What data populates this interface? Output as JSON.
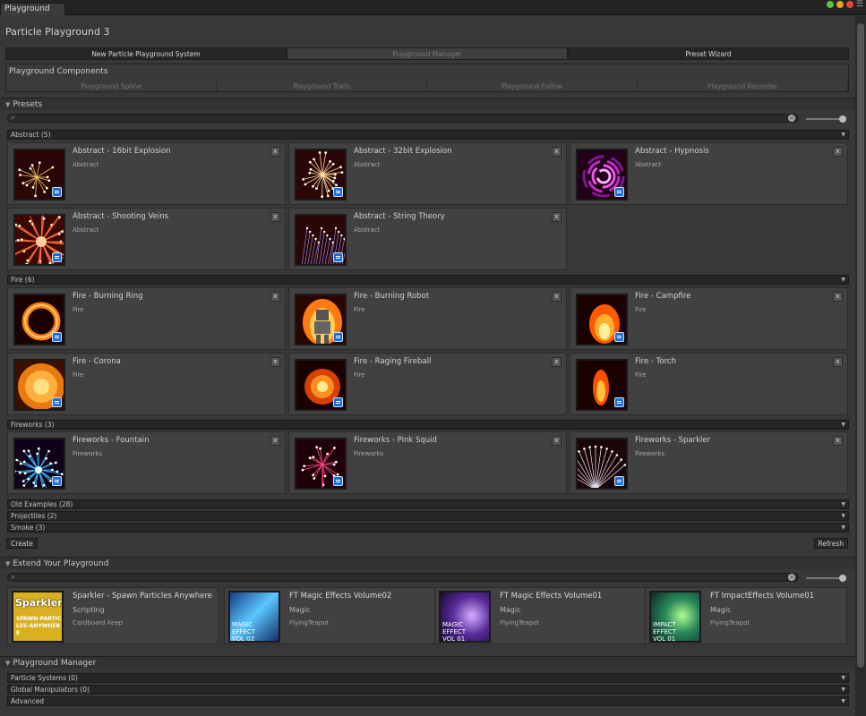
{
  "window": {
    "tab_label": "Playground",
    "colors": {
      "green": "#5ec13a",
      "yellow": "#e6a124",
      "red": "#e2463a"
    }
  },
  "header": {
    "title": "Particle Playground 3"
  },
  "top_buttons": [
    "New Particle Playground System",
    "Playground Manager",
    "Preset Wizard"
  ],
  "components": {
    "heading": "Playground Components",
    "buttons": [
      "Playground Spline",
      "Playground Trails",
      "Playground Follow",
      "Playground Recorder"
    ]
  },
  "presets": {
    "heading": "Presets",
    "categories": [
      {
        "label": "Abstract (5)",
        "items": [
          {
            "title": "Abstract - 16bit Explosion",
            "category": "Abstract",
            "art": "burst"
          },
          {
            "title": "Abstract - 32bit Explosion",
            "category": "Abstract",
            "art": "burst2"
          },
          {
            "title": "Abstract - Hypnosis",
            "category": "Abstract",
            "art": "swirl"
          },
          {
            "title": "Abstract - Shooting Veins",
            "category": "Abstract",
            "art": "veins"
          },
          {
            "title": "Abstract - String Theory",
            "category": "Abstract",
            "art": "strings"
          }
        ]
      },
      {
        "label": "Fire (6)",
        "items": [
          {
            "title": "Fire - Burning Ring",
            "category": "Fire",
            "art": "ring"
          },
          {
            "title": "Fire - Burning Robot",
            "category": "Fire",
            "art": "robot"
          },
          {
            "title": "Fire - Campfire",
            "category": "Fire",
            "art": "campfire"
          },
          {
            "title": "Fire - Corona",
            "category": "Fire",
            "art": "corona"
          },
          {
            "title": "Fire - Raging Fireball",
            "category": "Fire",
            "art": "fireball"
          },
          {
            "title": "Fire - Torch",
            "category": "Fire",
            "art": "torch"
          }
        ]
      },
      {
        "label": "Fireworks (3)",
        "items": [
          {
            "title": "Fireworks - Fountain",
            "category": "Fireworks",
            "art": "fountain"
          },
          {
            "title": "Fireworks - Pink Squid",
            "category": "Fireworks",
            "art": "squid"
          },
          {
            "title": "Fireworks - Sparkler",
            "category": "Fireworks",
            "art": "sparkler"
          }
        ]
      }
    ],
    "collapsed": [
      "Old Examples (28)",
      "Projectiles (2)",
      "Smoke (3)"
    ],
    "create_label": "Create",
    "refresh_label": "Refresh",
    "remove_label": "x"
  },
  "extend": {
    "heading": "Extend Your Playground",
    "items": [
      {
        "title": "Sparkler - Spawn Particles Anywhere",
        "category": "Scripting",
        "publisher": "Cardboard Keep",
        "thumb_text": "Sparkler",
        "thumb_sub": "SPAWN-PARTICLES-ANYWHERE"
      },
      {
        "title": "FT Magic Effects Volume02",
        "category": "Magic",
        "publisher": "FlyingTeapot",
        "thumb_text": "MAGIC EFFECT VOL 02"
      },
      {
        "title": "FT Magic Effects Volume01",
        "category": "Magic",
        "publisher": "FlyingTeapot",
        "thumb_text": "MAGIC EFFECT VOL 01"
      },
      {
        "title": "FT ImpactEffects Volume01",
        "category": "Magic",
        "publisher": "FlyingTeapot",
        "thumb_text": "IMPACT EFFECT VOL 01"
      }
    ]
  },
  "manager": {
    "heading": "Playground Manager",
    "rows": [
      "Particle Systems (0)",
      "Global Manipulators (0)",
      "Advanced"
    ]
  }
}
